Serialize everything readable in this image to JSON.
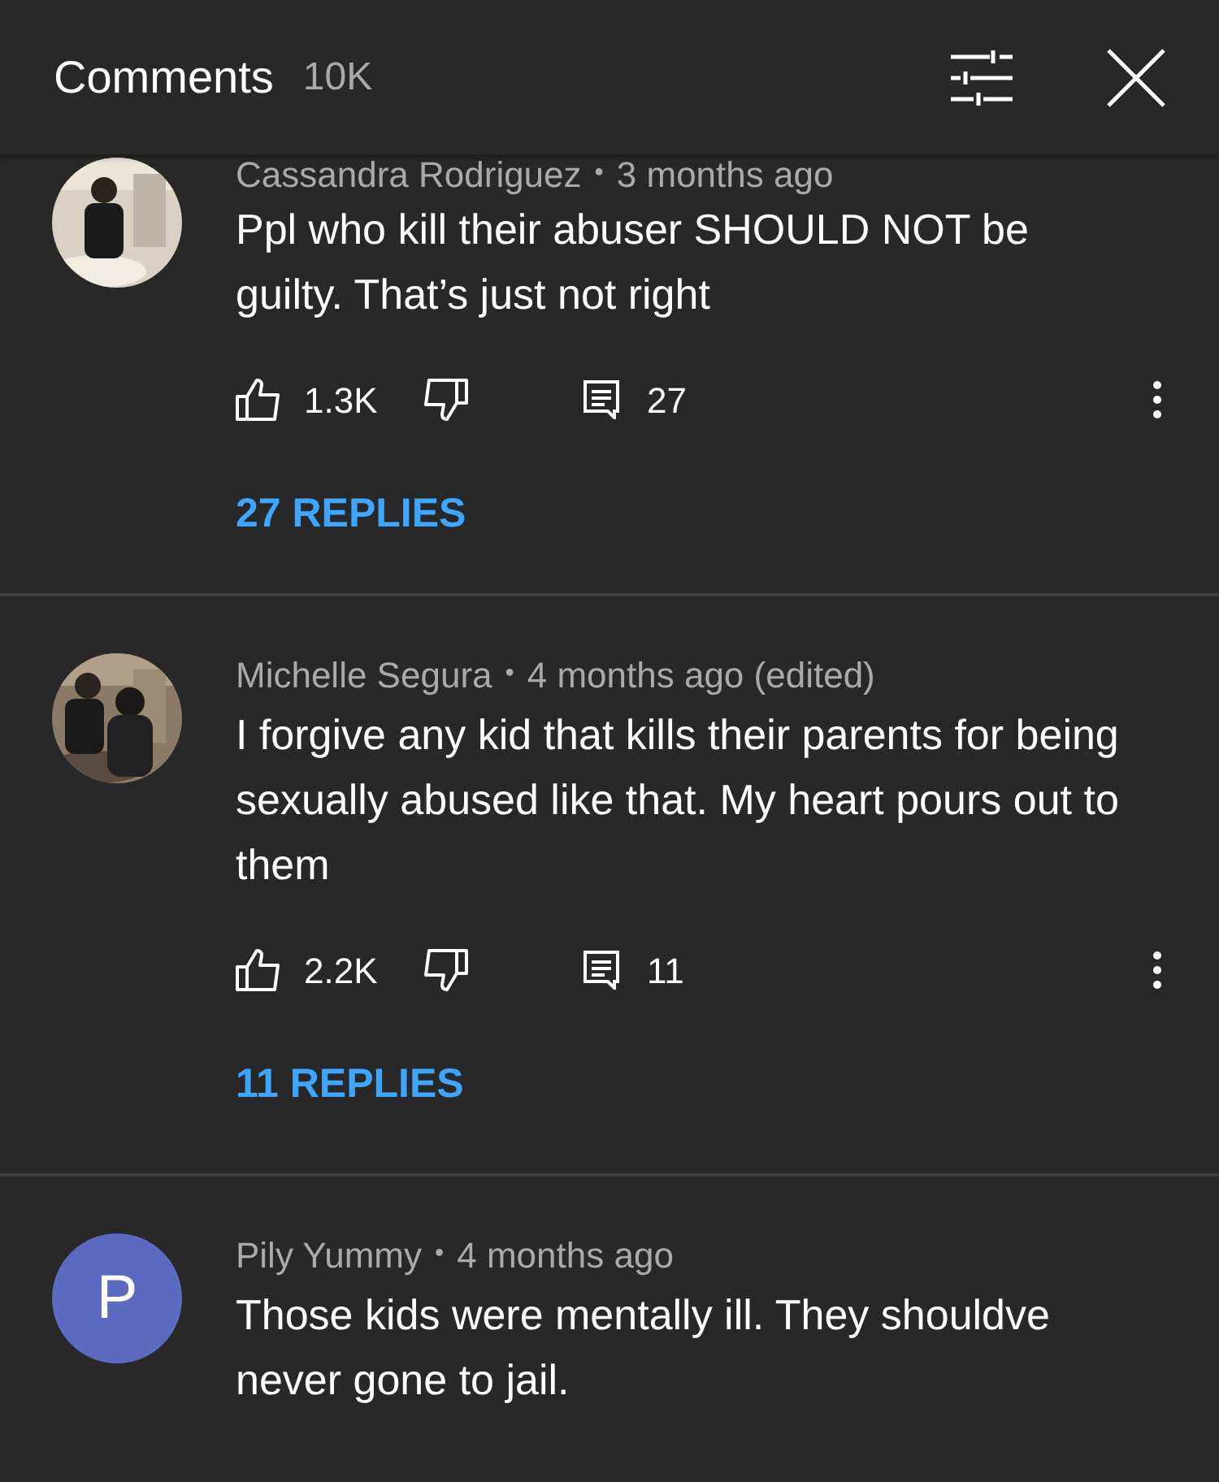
{
  "header": {
    "title": "Comments",
    "count": "10K"
  },
  "comments": [
    {
      "author": "Cassandra Rodriguez",
      "separator": "•",
      "time": "3 months ago",
      "text": "Ppl who kill their abuser SHOULD NOT be guilty. That’s just not right",
      "likes": "1.3K",
      "reply_count": "27",
      "replies_link": "27 REPLIES"
    },
    {
      "author": "Michelle Segura",
      "separator": "•",
      "time": "4 months ago (edited)",
      "text": "I forgive any kid that kills their parents for being sexually abused like that. My heart pours out to them",
      "likes": "2.2K",
      "reply_count": "11",
      "replies_link": "11 REPLIES"
    },
    {
      "author": "Pily Yummy",
      "separator": "•",
      "time": "4 months ago",
      "avatar": {
        "kind": "letter",
        "letter": "P",
        "color": "#5c6bc0"
      },
      "text": "Those kids were mentally ill. They shouldve never gone to jail."
    }
  ]
}
